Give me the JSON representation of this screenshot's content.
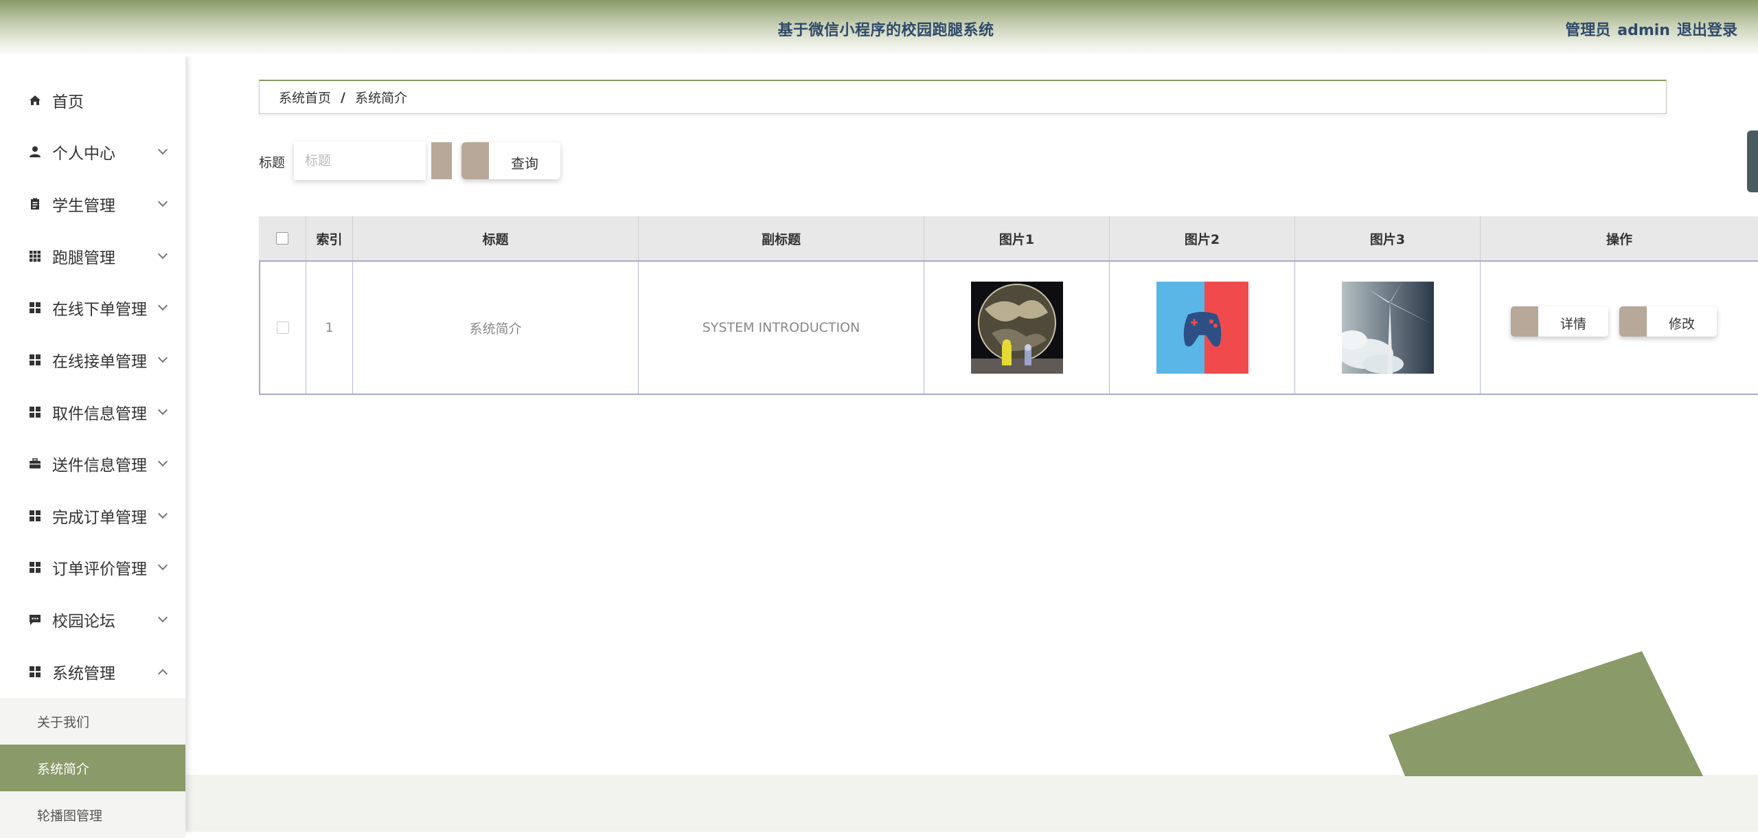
{
  "header": {
    "title": "基于微信小程序的校园跑腿系统",
    "role": "管理员",
    "username": "admin",
    "logout": "退出登录"
  },
  "sidebar": {
    "items": [
      {
        "label": "首页",
        "icon": "home-icon"
      },
      {
        "label": "个人中心",
        "icon": "person-icon"
      },
      {
        "label": "学生管理",
        "icon": "clipboard-icon"
      },
      {
        "label": "跑腿管理",
        "icon": "grid9-icon"
      },
      {
        "label": "在线下单管理",
        "icon": "grid4-icon"
      },
      {
        "label": "在线接单管理",
        "icon": "grid4-icon"
      },
      {
        "label": "取件信息管理",
        "icon": "grid4-icon"
      },
      {
        "label": "送件信息管理",
        "icon": "briefcase-icon"
      },
      {
        "label": "完成订单管理",
        "icon": "grid4-icon"
      },
      {
        "label": "订单评价管理",
        "icon": "grid4-icon"
      },
      {
        "label": "校园论坛",
        "icon": "chat-icon"
      },
      {
        "label": "系统管理",
        "icon": "grid4-icon"
      }
    ],
    "subitems": [
      {
        "label": "关于我们"
      },
      {
        "label": "系统简介"
      },
      {
        "label": "轮播图管理"
      }
    ]
  },
  "breadcrumb": {
    "home": "系统首页",
    "separator": "/",
    "current": "系统简介"
  },
  "search": {
    "label": "标题",
    "placeholder": "标题",
    "button": "查询"
  },
  "table": {
    "headers": {
      "index": "索引",
      "title": "标题",
      "subtitle": "副标题",
      "pic1": "图片1",
      "pic2": "图片2",
      "pic3": "图片3",
      "actions": "操作"
    },
    "rows": [
      {
        "index": "1",
        "title": "系统简介",
        "subtitle": "SYSTEM INTRODUCTION",
        "detail": "详情",
        "edit": "修改"
      }
    ]
  },
  "colors": {
    "accent": "#8a9a68",
    "button_accent": "#b8a89a",
    "header_text": "#2f4a6a"
  }
}
